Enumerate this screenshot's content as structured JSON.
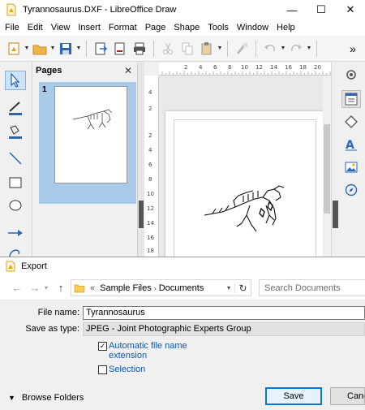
{
  "window": {
    "title": "Tyrannosaurus.DXF - LibreOffice Draw",
    "minimize": "—",
    "maximize": "☐",
    "close": "✕"
  },
  "menu": [
    "File",
    "Edit",
    "View",
    "Insert",
    "Format",
    "Page",
    "Shape",
    "Tools",
    "Window",
    "Help"
  ],
  "pages_pane": {
    "title": "Pages",
    "close": "✕",
    "page_number": "1"
  },
  "ruler": {
    "h_numbers": [
      "2",
      "4",
      "6",
      "8",
      "10",
      "12",
      "14",
      "16",
      "18",
      "20"
    ],
    "v_numbers": [
      "4",
      "2",
      "2",
      "4",
      "6",
      "8",
      "10",
      "12",
      "14",
      "16",
      "18"
    ]
  },
  "dialog": {
    "title": "Export",
    "back": "←",
    "forward": "→",
    "up": "↑",
    "path_prefix": "«",
    "path": [
      "Sample Files",
      "Documents"
    ],
    "search_placeholder": "Search Documents",
    "file_name_label": "File name:",
    "file_name": "Tyrannosaurus",
    "save_as_type_label": "Save as type:",
    "save_as_type": "JPEG - Joint Photographic Experts Group",
    "auto_ext_label_1": "Automatic file name",
    "auto_ext_label_2": "extension",
    "auto_ext_checked": true,
    "selection_label": "Selection",
    "selection_checked": false,
    "browse_folders": "Browse Folders",
    "save_button": "Save",
    "cancel_button": "Cancel"
  },
  "colors": {
    "accent": "#0078d7",
    "link": "#0a57b5",
    "page_selection": "#a9c9e8"
  }
}
